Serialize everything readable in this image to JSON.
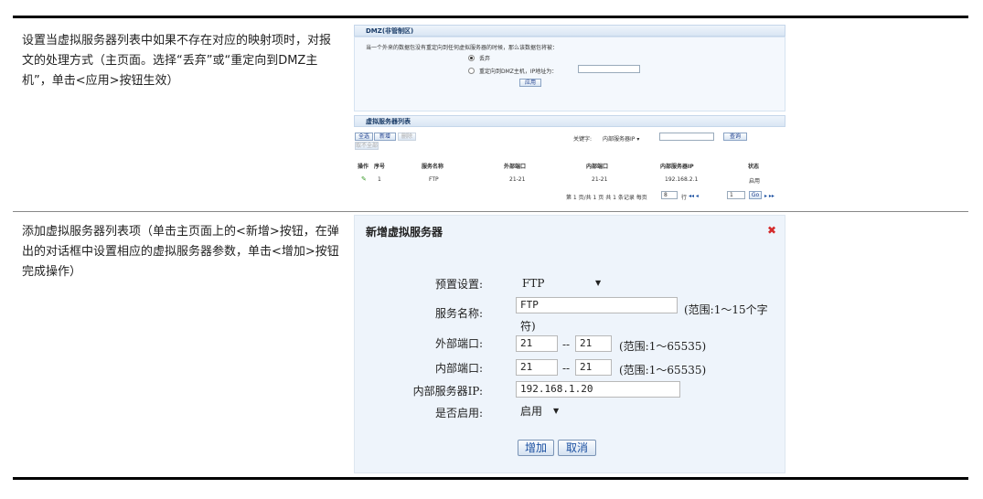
{
  "rows": [
    {
      "description": "设置当虚拟服务器列表中如果不存在对应的映射项时，对报文的处理方式（主页面。选择“丢弃”或“重定向到DMZ主机”，单击<应用>按钮生效）"
    },
    {
      "description": "添加虚拟服务器列表项（单击主页面上的<新增>按钮，在弹出的对话框中设置相应的虚拟服务器参数，单击<增加>按钮完成操作）"
    }
  ],
  "dmz": {
    "title": "DMZ(非管制区)",
    "prompt": "当一个外来的数据包没有重定向到任何虚拟服务器的时候，那么该数据包将被：",
    "option_drop": "丢弃",
    "option_redirect": "重定向到DMZ主机，IP地址为：",
    "ip_value": "",
    "apply_label": "应用"
  },
  "vs_list": {
    "title": "虚拟服务器列表",
    "btn_select_all": "全选",
    "btn_add": "新增",
    "btn_delete": "删除",
    "btn_deselect": "取不全部",
    "keyword_label": "关键字:",
    "keyword_select": "内部服务器IP",
    "search_label": "查询",
    "columns": [
      "操作",
      "序号",
      "服务名称",
      "外部端口",
      "内部端口",
      "内部服务器IP",
      "状态"
    ],
    "row": {
      "index": "1",
      "service": "FTP",
      "ext_port": "21-21",
      "int_port": "21-21",
      "ip": "192.168.2.1",
      "status": "启用"
    },
    "pager_text": "第 1 页/共 1 页 共 1 条记录 每页",
    "per_page": "8",
    "per_page_unit": "行",
    "page_num": "1",
    "go_label": "Go"
  },
  "dialog": {
    "title": "新增虚拟服务器",
    "label_preset": "预置设置:",
    "preset_value": "FTP",
    "label_name": "服务名称:",
    "name_value": "FTP",
    "name_hint_1": "(范围:1～15个字",
    "name_hint_2": "符)",
    "label_ext_port": "外部端口:",
    "ext_port_from": "21",
    "ext_port_to": "21",
    "label_int_port": "内部端口:",
    "int_port_from": "21",
    "int_port_to": "21",
    "port_sep": "--",
    "port_hint": "(范围:1～65535)",
    "label_ip": "内部服务器IP:",
    "ip_value": "192.168.1.20",
    "label_enable": "是否启用:",
    "enable_value": "启用",
    "add_label": "增加",
    "cancel_label": "取消"
  },
  "colors": {
    "accent": "#1a4fa0",
    "close": "#d42a2a",
    "panel": "#eef4fb"
  },
  "icons": [
    "close-icon",
    "edit-icon",
    "dropdown-arrow-icon"
  ]
}
